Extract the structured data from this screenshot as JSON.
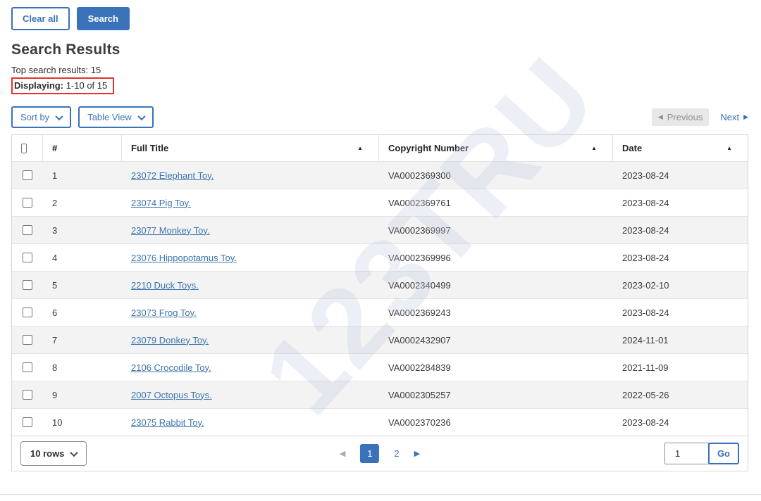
{
  "toolbar": {
    "clear_all_label": "Clear all",
    "search_label": "Search"
  },
  "heading": "Search Results",
  "summary": {
    "top_results": "Top search results: 15",
    "displaying_label": "Displaying:",
    "displaying_value": " 1-10 of 15"
  },
  "controls": {
    "sort_by_label": "Sort by",
    "table_view_label": "Table View"
  },
  "pagination_top": {
    "previous_label": "Previous",
    "next_label": "Next"
  },
  "table": {
    "headers": {
      "number": "#",
      "full_title": "Full Title",
      "copyright_number": "Copyright Number",
      "date": "Date"
    },
    "sort_icon": "▲",
    "rows": [
      {
        "num": "1",
        "title": "23072 Elephant Toy.",
        "copyright": "VA0002369300",
        "date": "2023-08-24"
      },
      {
        "num": "2",
        "title": "23074 Pig Toy.",
        "copyright": "VA0002369761",
        "date": "2023-08-24"
      },
      {
        "num": "3",
        "title": "23077 Monkey Toy.",
        "copyright": "VA0002369997",
        "date": "2023-08-24"
      },
      {
        "num": "4",
        "title": "23076 Hippopotamus Toy.",
        "copyright": "VA0002369996",
        "date": "2023-08-24"
      },
      {
        "num": "5",
        "title": "2210 Duck Toys.",
        "copyright": "VA0002340499",
        "date": "2023-02-10"
      },
      {
        "num": "6",
        "title": "23073 Frog Toy.",
        "copyright": "VA0002369243",
        "date": "2023-08-24"
      },
      {
        "num": "7",
        "title": "23079 Donkey Toy.",
        "copyright": "VA0002432907",
        "date": "2024-11-01"
      },
      {
        "num": "8",
        "title": "2106 Crocodile Toy.",
        "copyright": "VA0002284839",
        "date": "2021-11-09"
      },
      {
        "num": "9",
        "title": "2007 Octopus Toys.",
        "copyright": "VA0002305257",
        "date": "2022-05-26"
      },
      {
        "num": "10",
        "title": "23075 Rabbit Toy.",
        "copyright": "VA0002370236",
        "date": "2023-08-24"
      }
    ]
  },
  "footer": {
    "rows_select_label": "10 rows",
    "pages": [
      "1",
      "2"
    ],
    "page_input_value": "1",
    "go_label": "Go"
  },
  "icons": {
    "prev_triangle": "◀",
    "next_triangle": "▶"
  },
  "watermark_text": "123TRU",
  "colors": {
    "primary_blue": "#3a72ba",
    "link_blue": "#3c74ad",
    "annotation_red": "#e4322d",
    "row_alt_gray": "#f3f3f3",
    "disabled_gray": "#e8e8e8"
  }
}
